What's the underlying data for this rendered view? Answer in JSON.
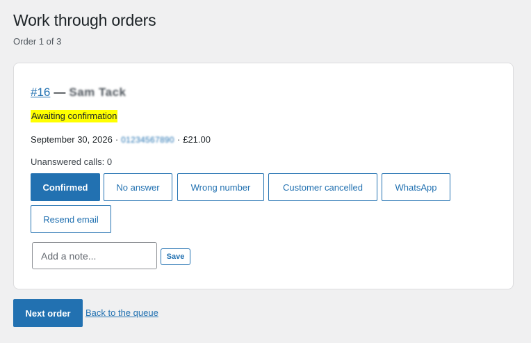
{
  "page": {
    "title": "Work through orders",
    "progress": "Order 1 of 3"
  },
  "order": {
    "number": "#16",
    "dash": "—",
    "customer_name": "Sam Tack",
    "status": "Awaiting confirmation",
    "date": "September 30, 2026",
    "separator": "·",
    "phone": "01234567890",
    "total": "£21.00",
    "unanswered_calls": "Unanswered calls: 0"
  },
  "actions": {
    "confirmed": "Confirmed",
    "no_answer": "No answer",
    "wrong_number": "Wrong number",
    "customer_cancelled": "Customer cancelled",
    "whatsapp": "WhatsApp",
    "resend_email": "Resend email"
  },
  "note": {
    "placeholder": "Add a note...",
    "save_label": "Save"
  },
  "footer": {
    "next_label": "Next order",
    "back_label": "Back to the queue"
  },
  "colors": {
    "accent": "#2271b1",
    "status_highlight": "#ffff00",
    "background": "#f0f0f1"
  }
}
